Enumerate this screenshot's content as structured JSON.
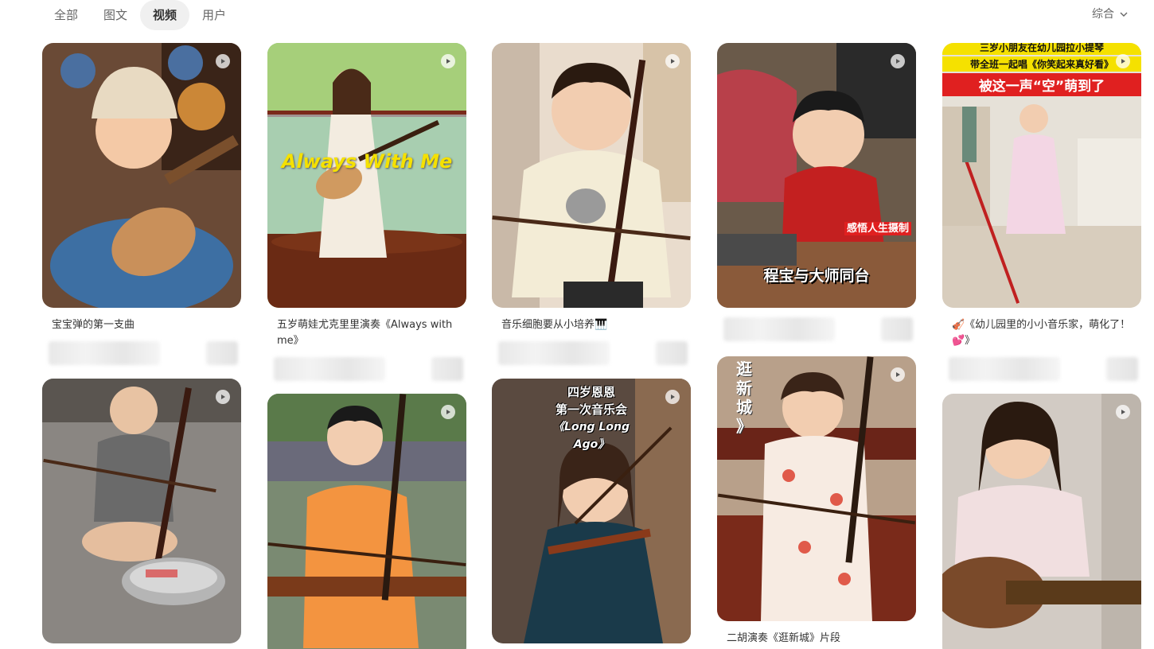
{
  "tabs": [
    {
      "label": "全部",
      "active": false
    },
    {
      "label": "图文",
      "active": false
    },
    {
      "label": "视频",
      "active": true
    },
    {
      "label": "用户",
      "active": false
    }
  ],
  "sort": {
    "label": "综合",
    "icon": "chevron-down-icon"
  },
  "cards": [
    {
      "title": "宝宝弹的第一支曲",
      "overlay_lines": []
    },
    {
      "title": "五岁萌娃尤克里里演奏《Always with me》",
      "overlay_lines": [
        "Always With Me"
      ]
    },
    {
      "title": "音乐细胞要从小培养🎹",
      "overlay_lines": []
    },
    {
      "title": "",
      "overlay_lines": [
        "感悟人生摄制",
        "程宝与大师同台"
      ]
    },
    {
      "title": "🎻《幼儿园里的小小音乐家，萌化了！💕》",
      "overlay_lines": [
        "三岁小朋友在幼儿园拉小提琴",
        "带全班一起唱《你笑起来真好看》",
        "被这一声“空”萌到了"
      ]
    },
    {
      "title": "",
      "overlay_lines": []
    },
    {
      "title": "",
      "overlay_lines": []
    },
    {
      "title": "",
      "overlay_lines": [
        "四岁恩恩",
        "第一次音乐会",
        "《Long Long",
        "Ago》"
      ]
    },
    {
      "title": "二胡演奏《逛新城》片段",
      "overlay_lines": [
        "逛",
        "新",
        "城",
        "》"
      ]
    },
    {
      "title": "",
      "overlay_lines": []
    }
  ],
  "colors": {
    "tab_active_bg": "#f0f0f0",
    "text_primary": "#333333",
    "text_secondary": "#666666",
    "overlay_yellow": "#f5e100",
    "overlay_red": "#e02020"
  }
}
